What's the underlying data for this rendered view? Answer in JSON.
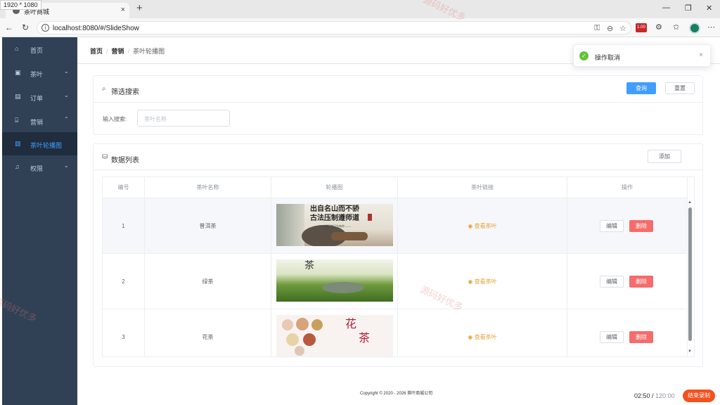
{
  "browser": {
    "size_badge": "1920 * 1080",
    "tab_title": "茶叶商城",
    "tab_close": "×",
    "new_tab": "+",
    "url": "localhost:8080/#/SlideShow",
    "ext_badge": "1.00",
    "win_min": "—",
    "win_max": "❐",
    "win_close": "✕"
  },
  "sidebar": {
    "items": [
      {
        "label": "首页",
        "icon": "home-icon",
        "glyph": "⌂",
        "arrow": ""
      },
      {
        "label": "茶叶",
        "icon": "box-icon",
        "glyph": "▣",
        "arrow": "⌄"
      },
      {
        "label": "订单",
        "icon": "order-icon",
        "glyph": "▤",
        "arrow": "⌄"
      },
      {
        "label": "营销",
        "icon": "shop-icon",
        "glyph": "⌸",
        "arrow": "⌃"
      },
      {
        "label": "茶叶轮播图",
        "icon": "picture-icon",
        "glyph": "▨",
        "arrow": "",
        "active": true
      },
      {
        "label": "权限",
        "icon": "bell-icon",
        "glyph": "♫",
        "arrow": "⌄"
      }
    ]
  },
  "breadcrumb": {
    "home": "首页",
    "marketing": "营销",
    "current": "茶叶轮播图",
    "sep": "/"
  },
  "filter": {
    "title": "筛选搜索",
    "query_button": "查询",
    "reset_button": "重置",
    "search_label": "输入搜索:",
    "search_placeholder": "茶叶名称"
  },
  "list": {
    "title": "数据列表",
    "add_button": "添加",
    "columns": [
      "编号",
      "茶叶名称",
      "轮播图",
      "茶叶链接",
      "操作"
    ],
    "rows": [
      {
        "id": "1",
        "name": "普洱茶",
        "link": "查看茶叶",
        "edit": "编辑",
        "delete": "删除",
        "banner_text_1": "出自名山而不骄",
        "banner_text_2": "古法压制遵师道",
        "banner_text_3": "—— 道好茶只为有你 ——"
      },
      {
        "id": "2",
        "name": "绿茶",
        "link": "查看茶叶",
        "edit": "编辑",
        "delete": "删除",
        "banner_text_1": "茶"
      },
      {
        "id": "3",
        "name": "花茶",
        "link": "查看茶叶",
        "edit": "编辑",
        "delete": "删除",
        "banner_text_1": "花",
        "banner_text_2": "茶"
      }
    ]
  },
  "footer": {
    "copyright": "Copyright © 2020 - 2026   茶叶商城公司"
  },
  "recorder": {
    "elapsed": "02:50",
    "total": "120:00",
    "stop_button": "结束录制"
  },
  "toast": {
    "message": "操作取消",
    "close": "×"
  },
  "watermark": "源码好优多"
}
